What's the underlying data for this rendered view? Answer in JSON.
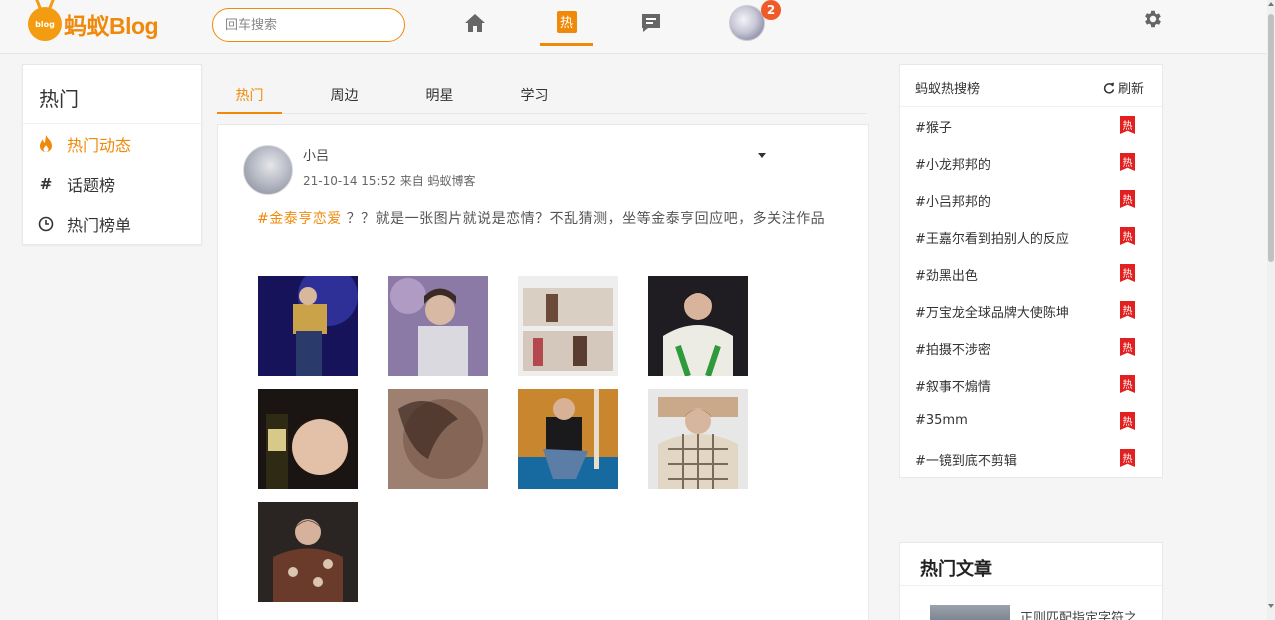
{
  "header": {
    "logo_badge_text": "blog",
    "logo_text": "蚂蚁Blog",
    "search_placeholder": "回车搜索",
    "nav": [
      {
        "name": "home",
        "icon": "home-icon"
      },
      {
        "name": "hot",
        "label": "热",
        "active": true
      },
      {
        "name": "messages",
        "icon": "message-icon"
      },
      {
        "name": "profile",
        "icon": "avatar"
      }
    ],
    "notification_count": "2",
    "settings_icon": "gear-icon",
    "accent_color": "#f0890a"
  },
  "left_nav": {
    "title": "热门",
    "items": [
      {
        "label": "热门动态",
        "icon": "fire-icon",
        "active": true
      },
      {
        "label": "话题榜",
        "icon": "hash-icon"
      },
      {
        "label": "热门榜单",
        "icon": "clock-icon"
      }
    ]
  },
  "tabs": [
    "热门",
    "周边",
    "明星",
    "学习"
  ],
  "post": {
    "author": "小吕",
    "time": "21-10-14 15:52",
    "source": "来自 蚂蚁博客",
    "tag": "#金泰亨恋爱",
    "text": "？？就是一张图片就说是恋情？不乱猜测，坐等金泰亨回应吧，多关注作品"
  },
  "hot_search": {
    "title": "蚂蚁热搜榜",
    "refresh_label": "刷新",
    "badge_label": "热",
    "badge_color": "#e32020",
    "items": [
      "#猴子",
      "#小龙邦邦的",
      "#小吕邦邦的",
      "#王嘉尔看到拍别人的反应",
      "#劲黑出色",
      "#万宝龙全球品牌大使陈坤",
      "#拍摄不涉密",
      "#叙事不煽情",
      "#35mm",
      "#一镜到底不剪辑"
    ]
  },
  "hot_articles": {
    "title": "热门文章",
    "first_snippet": "正则匹配指定字符之"
  }
}
